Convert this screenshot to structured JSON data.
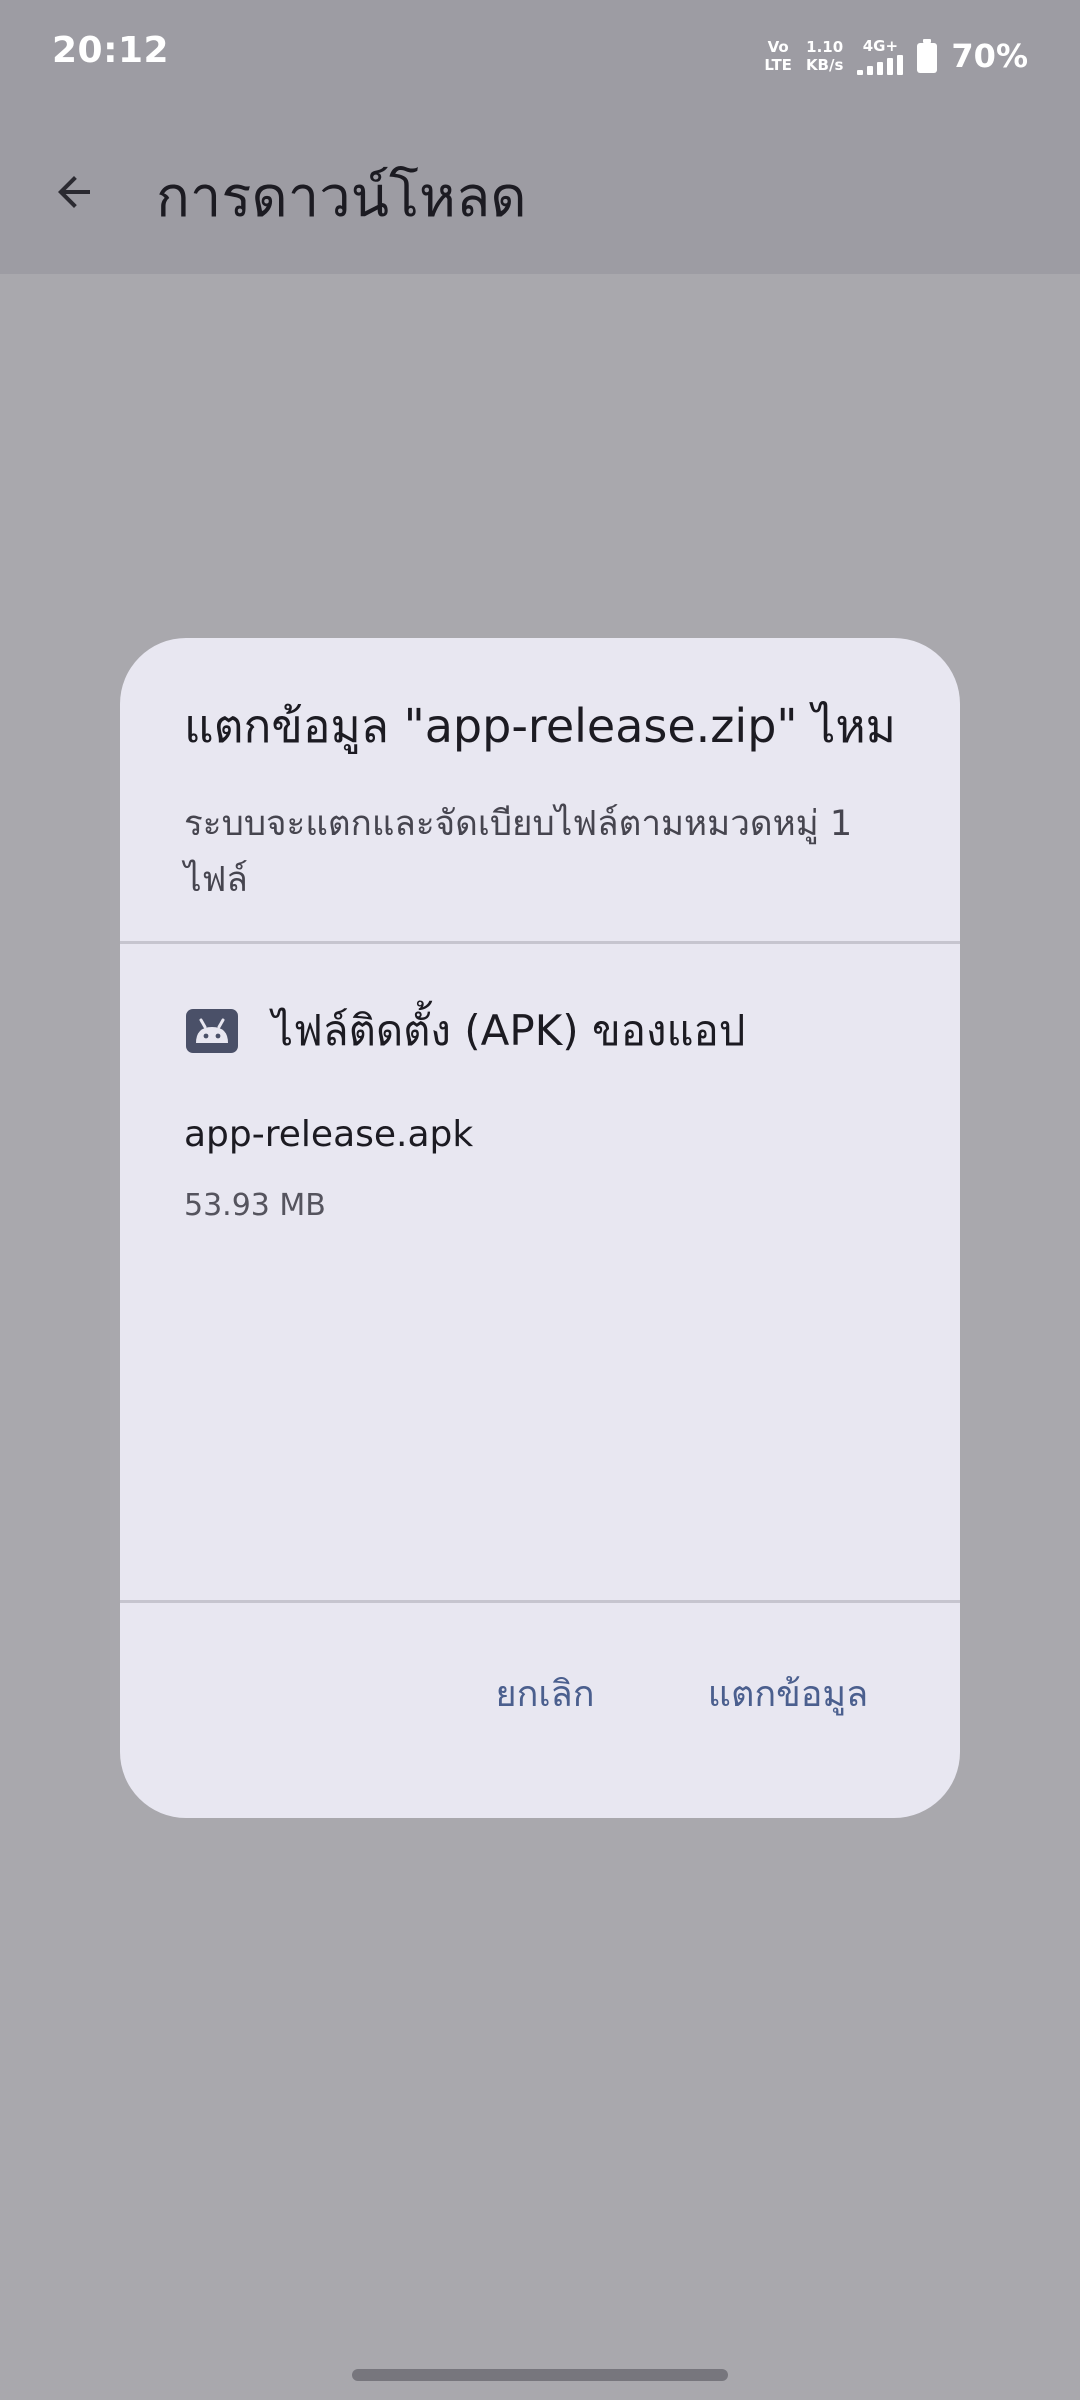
{
  "status_bar": {
    "time": "20:12",
    "volte_top": "Vo",
    "volte_bottom": "LTE",
    "speed_value": "1.10",
    "speed_unit": "KB/s",
    "network_type": "4G+",
    "battery_percent": "70%",
    "icons": [
      "volte-icon",
      "signal-icon",
      "battery-icon"
    ]
  },
  "app_bar": {
    "back_icon": "arrow-back-icon",
    "title": "การดาวน์โหลด"
  },
  "dialog": {
    "title": "แตกข้อมูล \"app-release.zip\" ไหม",
    "message": "ระบบจะแตกและจัดเบียบไฟล์ตามหมวดหมู่ 1 ไฟล์",
    "category": {
      "icon": "android-icon",
      "label": "ไฟล์ติดตั้ง (APK) ของแอป"
    },
    "file": {
      "name": "app-release.apk",
      "size": "53.93 MB"
    },
    "actions": {
      "cancel_label": "ยกเลิก",
      "extract_label": "แตกข้อมูล"
    }
  },
  "colors": {
    "scrim": "#a9a8ad",
    "app_bar": "#9d9ca3",
    "dialog_surface": "#e8e7f1",
    "action_text": "#4b5f8e",
    "divider": "#c6c5cf"
  }
}
